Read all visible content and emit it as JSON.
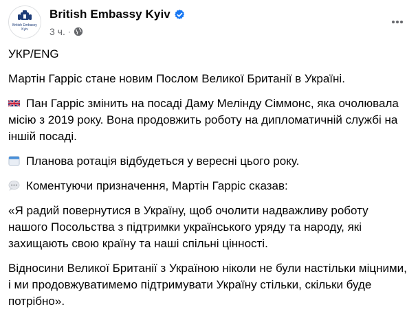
{
  "post": {
    "page_name": "British Embassy Kyiv",
    "timestamp": "3 ч.",
    "separator": "·",
    "avatar_text": "British Embassy Kyiv",
    "paragraphs": [
      {
        "emoji": "",
        "text": "УКР/ENG"
      },
      {
        "emoji": "",
        "text": "Мартін Гарріс стане новим Послом Великої Британії в Україні."
      },
      {
        "emoji": "uk-flag-icon",
        "text": "Пан Гарріс змінить на посаді Даму Мелінду Сіммонс, яка очолювала місію з 2019 року. Вона продовжить роботу на дипломатичній службі на іншій посаді."
      },
      {
        "emoji": "calendar-icon",
        "text": "Планова ротація відбудеться у вересні цього року."
      },
      {
        "emoji": "speech-bubble-icon",
        "text": "Коментуючи призначення, Мартін Гарріс сказав:"
      },
      {
        "emoji": "",
        "text": "«Я радий повернутися в Україну, щоб очолити надважливу роботу нашого Посольства з підтримки українського уряду та народу, які захищають свою країну та наші спільні цінності."
      },
      {
        "emoji": "",
        "text": "Відносини Великої Британії з Україною ніколи не були настільки міцними, і ми продовжуватимемо підтримувати Україну стільки, скільки буде потрібно»."
      }
    ]
  },
  "colors": {
    "text": "#050505",
    "secondary": "#65676b",
    "verified_blue": "#1877f2"
  },
  "icons": {
    "verified": "verified-badge-icon",
    "audience": "globe-icon",
    "more": "more-options-icon"
  }
}
